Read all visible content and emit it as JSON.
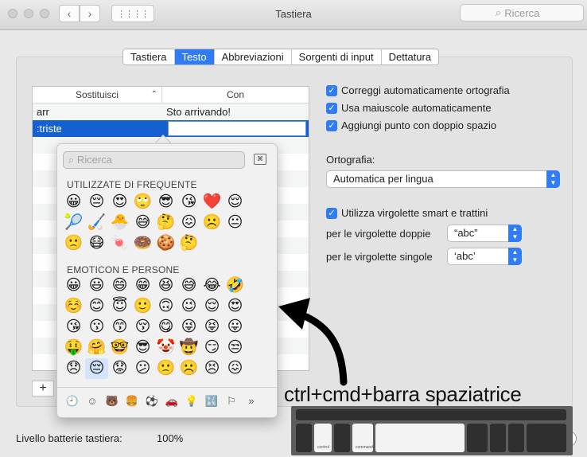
{
  "window": {
    "title": "Tastiera",
    "search_placeholder": "Ricerca"
  },
  "tabs": [
    {
      "label": "Tastiera",
      "active": false
    },
    {
      "label": "Testo",
      "active": true
    },
    {
      "label": "Abbreviazioni",
      "active": false
    },
    {
      "label": "Sorgenti di input",
      "active": false
    },
    {
      "label": "Dettatura",
      "active": false
    }
  ],
  "table": {
    "columns": [
      "Sostituisci",
      "Con"
    ],
    "rows": [
      {
        "replace": "arr",
        "with": "Sto arrivando!",
        "selected": false
      },
      {
        "replace": ":triste",
        "with": "",
        "selected": true
      }
    ],
    "add_label": "+"
  },
  "options": {
    "autocorrect": {
      "label": "Correggi automaticamente ortografia",
      "checked": true
    },
    "autocapitalize": {
      "label": "Usa maiuscole automaticamente",
      "checked": true
    },
    "double_space": {
      "label": "Aggiungi punto con doppio spazio",
      "checked": true
    },
    "spelling_label": "Ortografia:",
    "spelling_value": "Automatica per lingua",
    "smart_quotes": {
      "label": "Utilizza virgolette smart e trattini",
      "checked": true
    },
    "double_quotes_label": "per le virgolette doppie",
    "double_quotes_value": "“abc”",
    "single_quotes_label": "per le virgolette singole",
    "single_quotes_value": "‘abc’"
  },
  "battery": {
    "label": "Livello batterie tastiera:",
    "value": "100%"
  },
  "emoji_picker": {
    "search_placeholder": "Ricerca",
    "frequent_title": "UTILIZZATE DI FREQUENTE",
    "frequent": [
      "😀",
      "😔",
      "😍",
      "🙄",
      "😎",
      "😘",
      "❤️",
      "😌",
      "🎾",
      "🏑",
      "🐣",
      "😅",
      "🤔",
      "😖",
      "☹️",
      "😐",
      "🙁",
      "😷",
      "🍬",
      "🍩",
      "🍪",
      "🤔"
    ],
    "people_title": "EMOTICON E PERSONE",
    "people": [
      "😀",
      "😃",
      "😄",
      "😁",
      "😆",
      "😅",
      "😂",
      "🤣",
      "☺️",
      "😊",
      "😇",
      "🙂",
      "🙃",
      "😉",
      "😌",
      "😍",
      "😘",
      "😗",
      "😙",
      "😚",
      "😋",
      "😜",
      "😝",
      "😛",
      "🤑",
      "🤗",
      "🤓",
      "😎",
      "🤡",
      "🤠",
      "😏",
      "😒",
      "😞",
      "😔",
      "😟",
      "😕",
      "🙁",
      "☹️",
      "😣",
      "😖"
    ],
    "selected_index": 33,
    "categories": [
      {
        "name": "recent-icon",
        "glyph": "🕘",
        "active": true
      },
      {
        "name": "smiley-icon",
        "glyph": "☺",
        "active": false
      },
      {
        "name": "animal-icon",
        "glyph": "🐻",
        "active": false
      },
      {
        "name": "food-icon",
        "glyph": "🍔",
        "active": false
      },
      {
        "name": "sport-icon",
        "glyph": "⚽",
        "active": false
      },
      {
        "name": "travel-icon",
        "glyph": "🚗",
        "active": false
      },
      {
        "name": "object-icon",
        "glyph": "💡",
        "active": false
      },
      {
        "name": "symbol-icon",
        "glyph": "🔣",
        "active": false
      },
      {
        "name": "flag-icon",
        "glyph": "⚐",
        "active": false
      },
      {
        "name": "more-icon",
        "glyph": "»",
        "active": false
      }
    ]
  },
  "annotation": {
    "shortcut": "ctrl+cmd+barra spaziatrice",
    "key_labels": [
      "control",
      "command"
    ]
  }
}
